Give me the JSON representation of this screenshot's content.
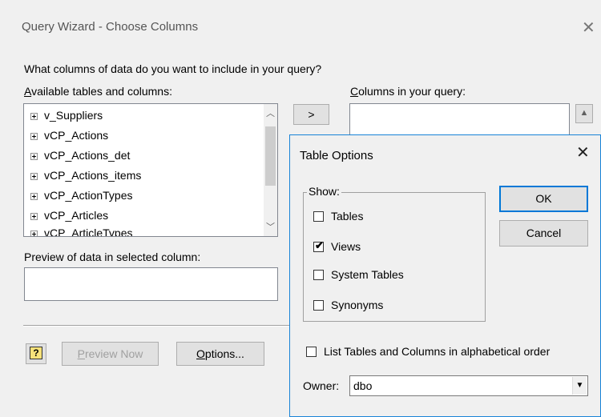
{
  "wizard": {
    "title": "Query Wizard - Choose Columns",
    "prompt": "What columns of data do you want to include in your query?",
    "available_label_first": "A",
    "available_label_rest": "vailable tables and columns:",
    "columns_label_first": "C",
    "columns_label_rest": "olumns in your query:",
    "move_button": ">",
    "tables": [
      "v_Suppliers",
      "vCP_Actions",
      "vCP_Actions_det",
      "vCP_Actions_items",
      "vCP_ActionTypes",
      "vCP_Articles",
      "vCP_ArticleTypes"
    ],
    "preview_label": "Preview of data in selected column:",
    "help_button": "?",
    "preview_now_first": "P",
    "preview_now_rest": "review Now",
    "options_first": "O",
    "options_rest": "ptions..."
  },
  "table_options": {
    "title": "Table Options",
    "show_label": "Show:",
    "items": [
      {
        "label": "Tables",
        "checked": false
      },
      {
        "label": "Views",
        "checked": true
      },
      {
        "label": "System Tables",
        "checked": false
      },
      {
        "label": "Synonyms",
        "checked": false
      }
    ],
    "ok": "OK",
    "cancel": "Cancel",
    "alphabetical_label": "List Tables and Columns in alphabetical order",
    "alphabetical_checked": false,
    "owner_label": "Owner:",
    "owner_value": "dbo"
  }
}
